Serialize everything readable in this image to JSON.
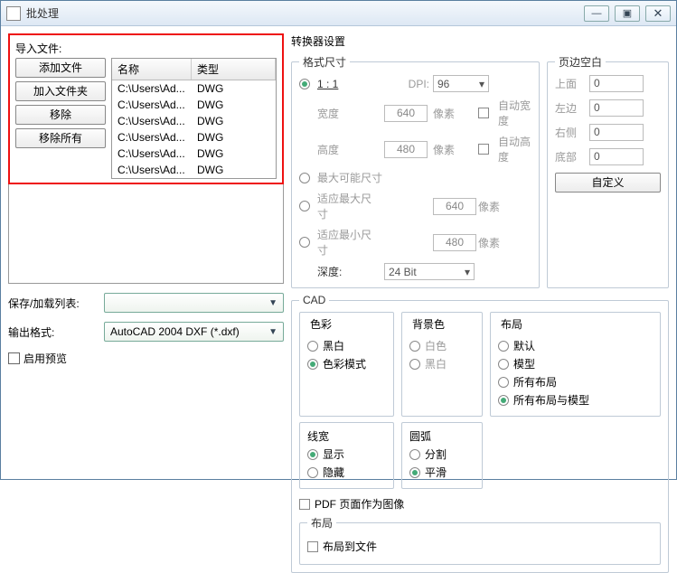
{
  "window": {
    "title": "批处理"
  },
  "import": {
    "label": "导入文件:",
    "buttons": {
      "add_file": "添加文件",
      "add_folder": "加入文件夹",
      "remove": "移除",
      "remove_all": "移除所有"
    },
    "columns": {
      "name": "名称",
      "type": "类型"
    },
    "rows": [
      {
        "name": "C:\\Users\\Ad...",
        "type": "DWG"
      },
      {
        "name": "C:\\Users\\Ad...",
        "type": "DWG"
      },
      {
        "name": "C:\\Users\\Ad...",
        "type": "DWG"
      },
      {
        "name": "C:\\Users\\Ad...",
        "type": "DWG"
      },
      {
        "name": "C:\\Users\\Ad...",
        "type": "DWG"
      },
      {
        "name": "C:\\Users\\Ad...",
        "type": "DWG"
      }
    ]
  },
  "save_list": {
    "label": "保存/加载列表:",
    "value": ""
  },
  "output_format": {
    "label": "输出格式:",
    "value": "AutoCAD 2004 DXF (*.dxf)"
  },
  "preview": {
    "label": "启用预览"
  },
  "converter": {
    "label": "转换器设置",
    "format": {
      "legend": "格式尺寸",
      "one_to_one": "1 : 1",
      "dpi_label": "DPI:",
      "dpi_value": "96",
      "width_label": "宽度",
      "width_value": "640",
      "px": "像素",
      "auto_width": "自动宽度",
      "height_label": "高度",
      "height_value": "480",
      "auto_height": "自动高度",
      "max_size": "最大可能尺寸",
      "fit_max": "适应最大尺寸",
      "fit_max_value": "640",
      "fit_min": "适应最小尺寸",
      "fit_min_value": "480",
      "depth_label": "深度:",
      "depth_value": "24 Bit"
    },
    "margin": {
      "legend": "页边空白",
      "top": "上面",
      "top_v": "0",
      "left": "左边",
      "left_v": "0",
      "right": "右侧",
      "right_v": "0",
      "bottom": "底部",
      "bottom_v": "0",
      "custom": "自定义"
    },
    "cad": {
      "legend": "CAD",
      "color": {
        "legend": "色彩",
        "bw": "黑白",
        "color_mode": "色彩模式"
      },
      "bg": {
        "legend": "背景色",
        "white": "白色",
        "black": "黑白"
      },
      "layout": {
        "legend": "布局",
        "default": "默认",
        "model": "模型",
        "all": "所有布局",
        "all_model": "所有布局与模型"
      },
      "linewidth": {
        "legend": "线宽",
        "show": "显示",
        "hide": "隐藏"
      },
      "arc": {
        "legend": "圆弧",
        "split": "分割",
        "smooth": "平滑"
      },
      "pdf_as_image": "PDF 页面作为图像",
      "layout2": {
        "legend": "布局",
        "to_file": "布局到文件"
      }
    }
  }
}
